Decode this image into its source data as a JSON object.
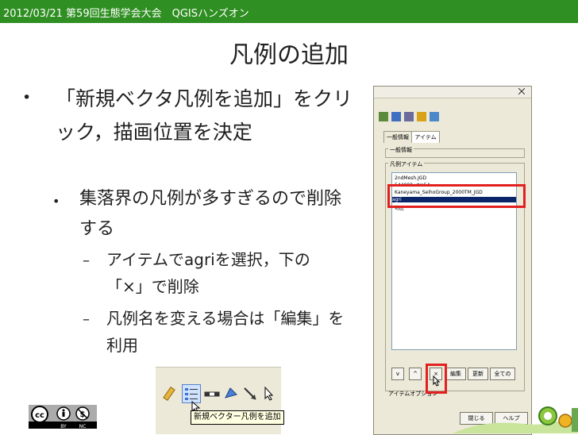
{
  "header": {
    "text": "2012/03/21 第59回生態学会大会　QGISハンズオン"
  },
  "slide": {
    "title": "凡例の追加",
    "bullet": "•",
    "sub_bullet": "•",
    "dash": "–",
    "level1_text": "「新規ベクタ凡例を追加」をクリック，描画位置を決定",
    "level2_text": "集落界の凡例が多すぎるので削除する",
    "level3_items": [
      "アイテムでagriを選択，下の「×」で削除",
      "凡例名を変える場合は「編集」を利用"
    ]
  },
  "toolbar_shot": {
    "tooltip": "新規ベクター凡例を追加"
  },
  "dialog_shot": {
    "tabs": [
      "一般情報",
      "アイテム"
    ],
    "group_general": "一般情報",
    "group_legend": "凡例アイテム",
    "list_items": [
      "2ndMesh.JGD",
      "544000 utm54",
      "Kaneyama_SeihoGroup_2000TM_JGD",
      "agri",
      "地区"
    ],
    "buttons": [
      "v",
      "^",
      "×",
      "編集",
      "更新",
      "全ての"
    ],
    "options_label": "アイテムオプション",
    "close_button": "閉じる",
    "help_button": "ヘルプ"
  },
  "license": {
    "icon": "creative-commons-by-nc"
  },
  "colors": {
    "header_bg": "#2f8f22",
    "highlight": "#e32020"
  }
}
